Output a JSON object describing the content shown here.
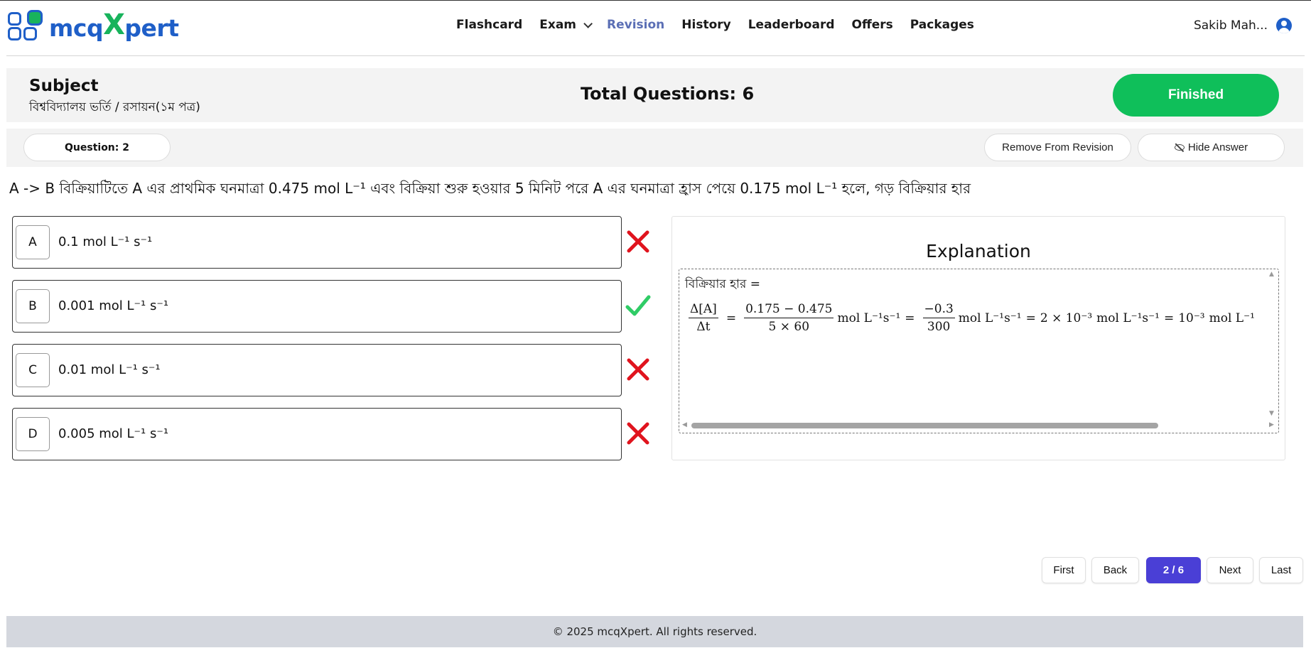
{
  "brand": {
    "name_left": "mcq",
    "name_x": "X",
    "name_right": "pert"
  },
  "nav": {
    "items": [
      {
        "label": "Flashcard",
        "active": false
      },
      {
        "label": "Exam",
        "active": false
      },
      {
        "label": "Revision",
        "active": true
      },
      {
        "label": "History",
        "active": false
      },
      {
        "label": "Leaderboard",
        "active": false
      },
      {
        "label": "Offers",
        "active": false
      },
      {
        "label": "Packages",
        "active": false
      }
    ],
    "active_color": "#5b6fb5"
  },
  "user": {
    "name": "Sakib Mah...",
    "icon": "user-circle-icon"
  },
  "subject": {
    "heading": "Subject",
    "path": "বিশ্ববিদ্যালয় ভর্তি / রসায়ন(১ম পত্র)",
    "total_questions": "Total Questions: 6",
    "status_button": "Finished",
    "status_color": "#0fbf5a"
  },
  "question": {
    "number_label": "Question: 2",
    "remove_label": "Remove From Revision",
    "hide_label": "Hide Answer",
    "text": "A -> B বিক্রিয়াটিতে A এর প্রাথমিক ঘনমাত্রা 0.475 mol L⁻¹ এবং বিক্রিয়া শুরু হওয়ার 5 মিনিট পরে A এর ঘনমাত্রা হ্রাস পেয়ে 0.175 mol L⁻¹ হলে, গড় বিক্রিয়ার হার"
  },
  "options": [
    {
      "letter": "A",
      "text": "0.1 mol L⁻¹ s⁻¹",
      "result": "wrong"
    },
    {
      "letter": "B",
      "text": "0.001 mol L⁻¹ s⁻¹",
      "result": "correct"
    },
    {
      "letter": "C",
      "text": "0.01 mol L⁻¹ s⁻¹",
      "result": "wrong"
    },
    {
      "letter": "D",
      "text": "0.005 mol L⁻¹ s⁻¹",
      "result": "wrong"
    }
  ],
  "explanation": {
    "title": "Explanation",
    "lead": "বিক্রিয়ার হার =",
    "math": {
      "lhs_num": "Δ[A]",
      "lhs_den": "Δt",
      "eq": "=",
      "f1_num": "0.175 − 0.475",
      "f1_den": "5 × 60",
      "unit1": "mol L⁻¹s⁻¹",
      "f2_num": "−0.3",
      "f2_den": "300",
      "unit2": "mol L⁻¹s⁻¹",
      "val3": "2 × 10⁻³",
      "unit3": "mol L⁻¹s⁻¹",
      "val4": "10⁻³",
      "unit4": "mol L⁻¹"
    }
  },
  "pagination": {
    "first": "First",
    "back": "Back",
    "current": "2 / 6",
    "next": "Next",
    "last": "Last",
    "current_color": "#4a3fd6"
  },
  "footer": {
    "text": "© 2025 mcqXpert. All rights reserved."
  },
  "colors": {
    "correct": "#2fcc66",
    "wrong": "#e0141e"
  }
}
